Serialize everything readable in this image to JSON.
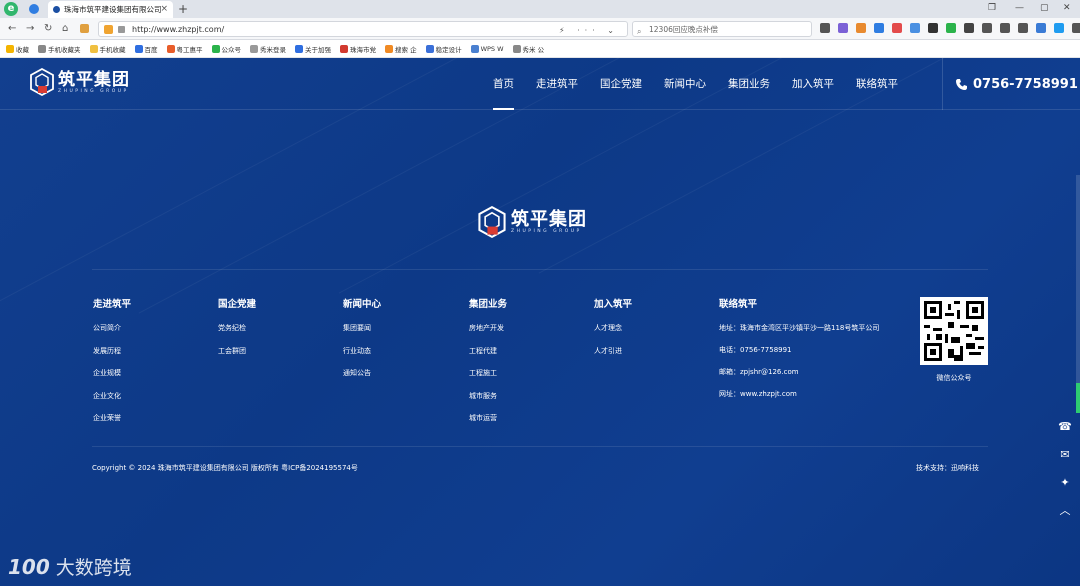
{
  "browser": {
    "tab_title": "珠海市筑平建设集团有限公司",
    "url": "http://www.zhzpjt.com/",
    "search_placeholder": "12306回应晚点补偿",
    "bookmarks": [
      "收藏",
      "手机收藏夹",
      "手机收藏",
      "百度",
      "粤工惠平",
      "公众号",
      "秀米登录",
      "关于加强",
      "珠海市党",
      "搜索 企",
      "稳定设计",
      "WPS W",
      "秀米 公"
    ]
  },
  "site": {
    "logo_cn": "筑平集团",
    "logo_en": "ZHUPING GROUP",
    "nav": [
      "首页",
      "走进筑平",
      "国企党建",
      "新闻中心",
      "集团业务",
      "加入筑平",
      "联络筑平"
    ],
    "phone": "0756-7758991"
  },
  "footer": {
    "columns": [
      {
        "title": "走进筑平",
        "links": [
          "公司简介",
          "发展历程",
          "企业规模",
          "企业文化",
          "企业荣誉"
        ]
      },
      {
        "title": "国企党建",
        "links": [
          "党务纪检",
          "工会群团"
        ]
      },
      {
        "title": "新闻中心",
        "links": [
          "集团要闻",
          "行业动态",
          "通知公告"
        ]
      },
      {
        "title": "集团业务",
        "links": [
          "房地产开发",
          "工程代建",
          "工程施工",
          "城市服务",
          "城市运营"
        ]
      },
      {
        "title": "加入筑平",
        "links": [
          "人才理念",
          "人才引进"
        ]
      }
    ],
    "contact": {
      "title": "联络筑平",
      "address": "地址：珠海市金湾区平沙镇平沙一路118号筑平公司",
      "tel": "电话：0756-7758991",
      "email": "邮箱：zpjshr@126.com",
      "web": "网址：www.zhzpjt.com"
    },
    "qr_caption": "微信公众号",
    "copyright": "Copyright © 2024 珠海市筑平建设集团有限公司 版权所有 粤ICP备2024195574号",
    "tech_support": "技术支持：迅响科技"
  },
  "watermark": {
    "logo": "100",
    "text": "大数跨境"
  }
}
